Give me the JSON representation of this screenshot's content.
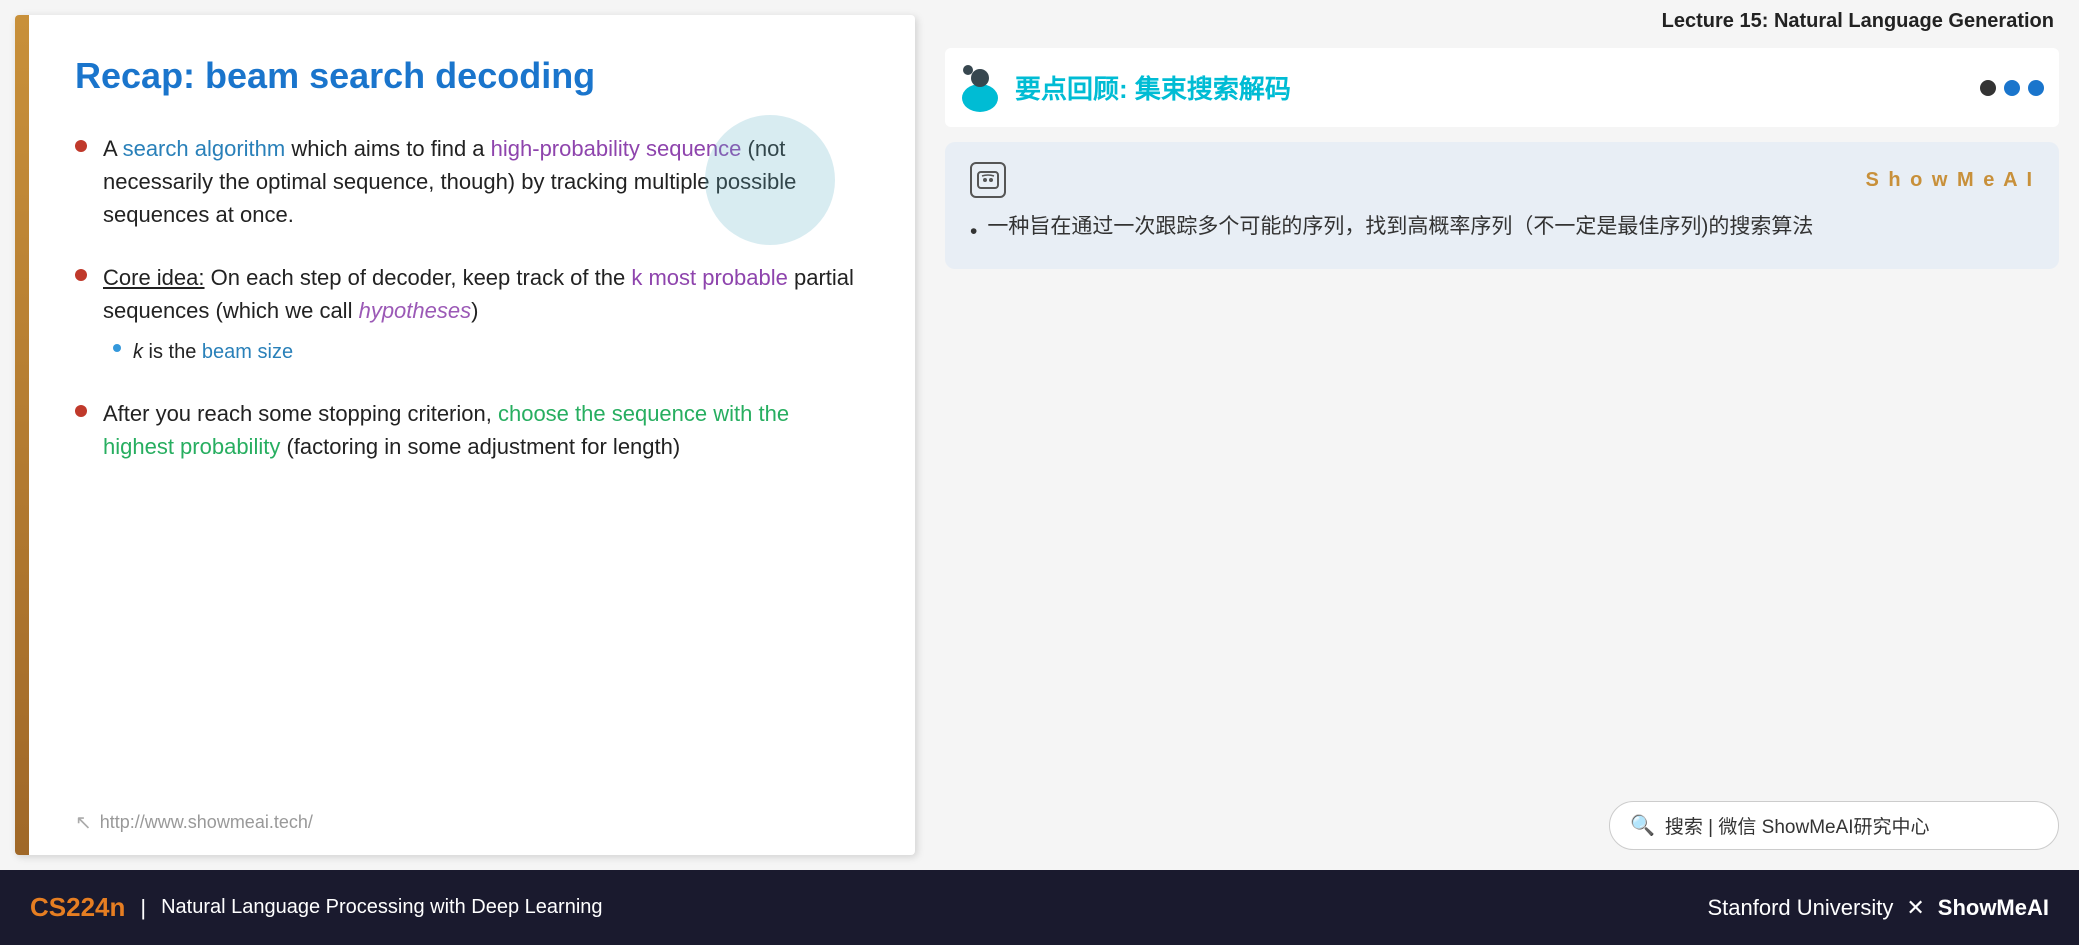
{
  "lecture": {
    "title": "Lecture 15: Natural Language Generation"
  },
  "slide": {
    "title": "Recap: beam search decoding",
    "bullet1": {
      "part1": "A ",
      "search_algorithm": "search algorithm",
      "part2": " which aims to find a ",
      "high_prob": "high-probability sequence",
      "part3": " (not necessarily the optimal sequence, though) by tracking multiple possible sequences at once."
    },
    "bullet2": {
      "core_idea": "Core idea:",
      "part1": " On each step of decoder, keep track of the ",
      "k_most": "k most probable",
      "part2": " partial sequences (which we call ",
      "hypotheses": "hypotheses",
      "part3": ")"
    },
    "sub_bullet": {
      "part1": "k",
      "part2": " is the ",
      "beam_size": "beam size"
    },
    "bullet3": {
      "part1": "After you reach some stopping criterion, ",
      "choose": "choose the sequence with the highest probability",
      "part2": " (factoring in some adjustment for length)"
    },
    "footer_url": "http://www.showmeai.tech/"
  },
  "right_panel": {
    "header_title": "要点回顾: 集束搜索解码",
    "nav_dots": [
      "dot1",
      "dot2",
      "dot3"
    ],
    "ai_card": {
      "showmeai_label": "S h o w M e A I",
      "content": "一种旨在通过一次跟踪多个可能的序列，找到高概率序列（不一定是最佳序列)的搜索算法"
    },
    "search_bar": "搜索 | 微信 ShowMeAI研究中心"
  },
  "bottom_bar": {
    "cs224n": "CS224n",
    "separator": "|",
    "course_name": "Natural Language Processing with Deep Learning",
    "stanford": "Stanford University",
    "x": "✕",
    "showmeai": "ShowMeAI"
  }
}
